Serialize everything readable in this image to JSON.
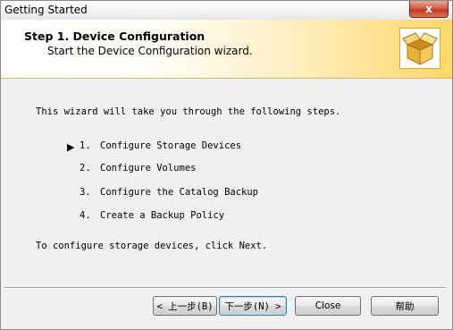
{
  "window": {
    "title": "Getting Started",
    "close_glyph": "x"
  },
  "banner": {
    "title": "Step 1.  Device Configuration",
    "subtitle": "Start the Device Configuration wizard.",
    "icon": "open-box-icon"
  },
  "content": {
    "intro": "This wizard will take you through the following steps.",
    "current_step_marker": "▶",
    "steps": [
      {
        "num": "1.",
        "label": "Configure Storage Devices"
      },
      {
        "num": "2.",
        "label": "Configure Volumes"
      },
      {
        "num": "3.",
        "label": "Configure the Catalog Backup"
      },
      {
        "num": "4.",
        "label": "Create a Backup Policy"
      }
    ],
    "outro": "To configure storage devices, click Next."
  },
  "buttons": {
    "back": "< 上一步(B)",
    "next": "下一步(N) >",
    "close": "Close",
    "help": "帮助"
  },
  "colors": {
    "banner_gradient_end": "#ffd66a",
    "close_button": "#c23a1e"
  }
}
